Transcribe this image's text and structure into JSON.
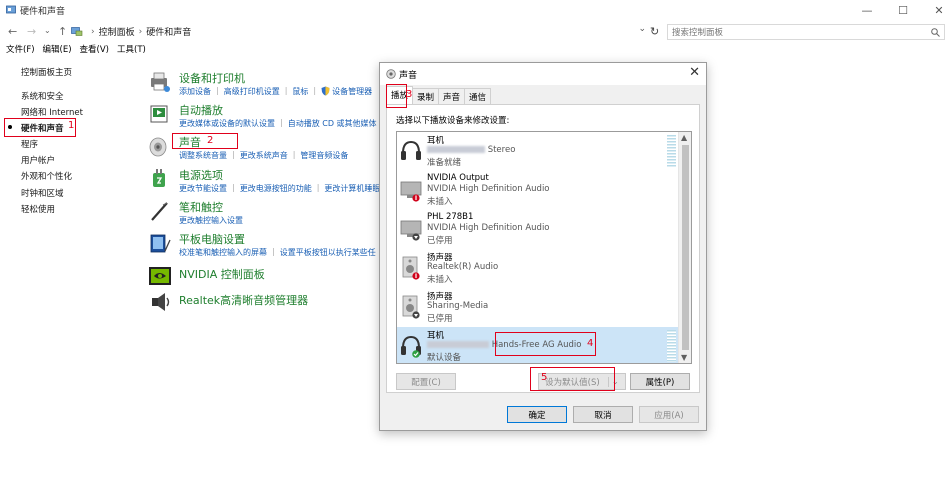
{
  "window": {
    "title": "硬件和声音",
    "minimize": "—",
    "maximize": "☐",
    "close": "✕"
  },
  "addressbar": {
    "crumbs": [
      "控制面板",
      "硬件和声音"
    ],
    "separator": "›",
    "search_placeholder": "搜索控制面板"
  },
  "menubar": [
    "文件(F)",
    "编辑(E)",
    "查看(V)",
    "工具(T)"
  ],
  "leftnav": {
    "items": [
      "控制面板主页",
      "系统和安全",
      "网络和 Internet",
      "硬件和声音",
      "程序",
      "用户帐户",
      "外观和个性化",
      "时钟和区域",
      "轻松使用"
    ]
  },
  "categories": [
    {
      "title": "设备和打印机",
      "links": [
        "添加设备",
        "高级打印机设置",
        "鼠标",
        "设备管理器"
      ]
    },
    {
      "title": "自动播放",
      "links": [
        "更改媒体或设备的默认设置",
        "自动播放 CD 或其他媒体"
      ]
    },
    {
      "title": "声音",
      "links": [
        "调整系统音量",
        "更改系统声音",
        "管理音频设备"
      ]
    },
    {
      "title": "电源选项",
      "links": [
        "更改节能设置",
        "更改电源按钮的功能",
        "更改计算机睡眠"
      ]
    },
    {
      "title": "笔和触控",
      "links": [
        "更改触控输入设置"
      ]
    },
    {
      "title": "平板电脑设置",
      "links": [
        "校准笔和触控输入的屏幕",
        "设置平板按钮以执行某些任"
      ]
    },
    {
      "title": "NVIDIA 控制面板",
      "links": []
    },
    {
      "title": "Realtek高清晰音频管理器",
      "links": []
    }
  ],
  "dialog": {
    "title": "声音",
    "tabs": [
      "播放",
      "录制",
      "声音",
      "通信"
    ],
    "instruction": "选择以下播放设备来修改设置:",
    "devices": [
      {
        "name": "耳机",
        "desc_suffix": "Stereo",
        "status": "准备就绪",
        "selected": false
      },
      {
        "name": "NVIDIA Output",
        "desc": "NVIDIA High Definition Audio",
        "status": "未插入",
        "selected": false
      },
      {
        "name": "PHL 278B1",
        "desc": "NVIDIA High Definition Audio",
        "status": "已停用",
        "selected": false
      },
      {
        "name": "扬声器",
        "desc": "Realtek(R) Audio",
        "status": "未插入",
        "selected": false
      },
      {
        "name": "扬声器",
        "desc": "Sharing-Media",
        "status": "已停用",
        "selected": false
      },
      {
        "name": "耳机",
        "desc_suffix": "Hands-Free AG Audio",
        "status": "默认设备",
        "selected": true
      }
    ],
    "buttons": {
      "configure": "配置(C)",
      "set_default": "设为默认值(S)",
      "properties": "属性(P)",
      "ok": "确定",
      "cancel": "取消",
      "apply": "应用(A)"
    }
  },
  "annotations": [
    "1",
    "2",
    "3",
    "4",
    "5"
  ],
  "colors": {
    "annotation_red": "#e0001b",
    "category_green": "#1e7e2d",
    "link_blue": "#1a5fb4",
    "selection_blue": "#cce4f7",
    "accent": "#0078d7"
  }
}
